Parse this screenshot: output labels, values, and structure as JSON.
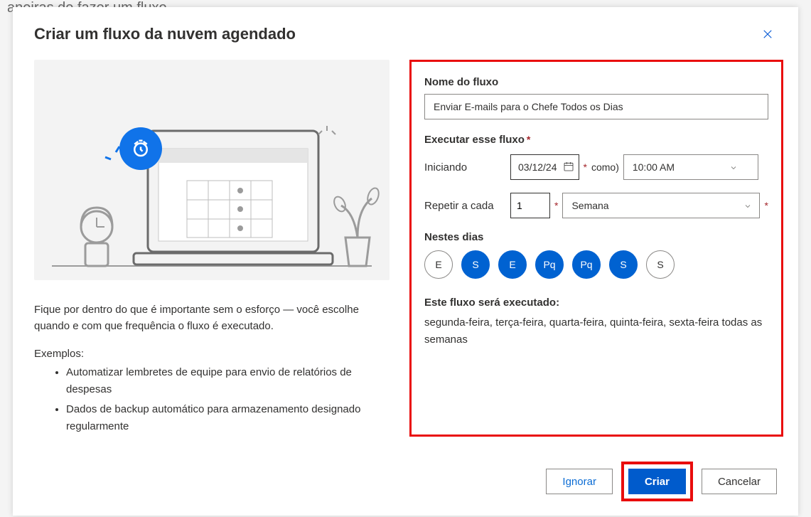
{
  "bg_hint": "aneiras de fazer um fluxo",
  "dialog": {
    "title": "Criar um fluxo da nuvem agendado",
    "description": "Fique por dentro do que é importante sem o esforço — você escolhe quando e com que frequência o fluxo é executado.",
    "examples_label": "Exemplos:",
    "examples": [
      "Automatizar lembretes de equipe para envio de relatórios de despesas",
      "Dados de backup automático para armazenamento designado regularmente"
    ]
  },
  "form": {
    "name_label": "Nome do fluxo",
    "name_value": "Enviar E-mails para o Chefe Todos os Dias",
    "run_section_label": "Executar esse fluxo",
    "starting_label": "Iniciando",
    "date_value": "03/12/24",
    "as_label": "como)",
    "time_value": "10:00 AM",
    "repeat_label": "Repetir a cada",
    "repeat_value": "1",
    "repeat_unit": "Semana",
    "days_label": "Nestes dias",
    "days": [
      {
        "label": "E",
        "selected": false
      },
      {
        "label": "S",
        "selected": true
      },
      {
        "label": "E",
        "selected": true
      },
      {
        "label": "Pq",
        "selected": true
      },
      {
        "label": "Pq",
        "selected": true
      },
      {
        "label": "S",
        "selected": true
      },
      {
        "label": "S",
        "selected": false
      }
    ],
    "schedule_heading": "Este fluxo será executado:",
    "schedule_text": "segunda-feira, terça-feira, quarta-feira, quinta-feira, sexta-feira todas as semanas"
  },
  "footer": {
    "skip": "Ignorar",
    "create": "Criar",
    "cancel": "Cancelar"
  },
  "required_marker": "*"
}
